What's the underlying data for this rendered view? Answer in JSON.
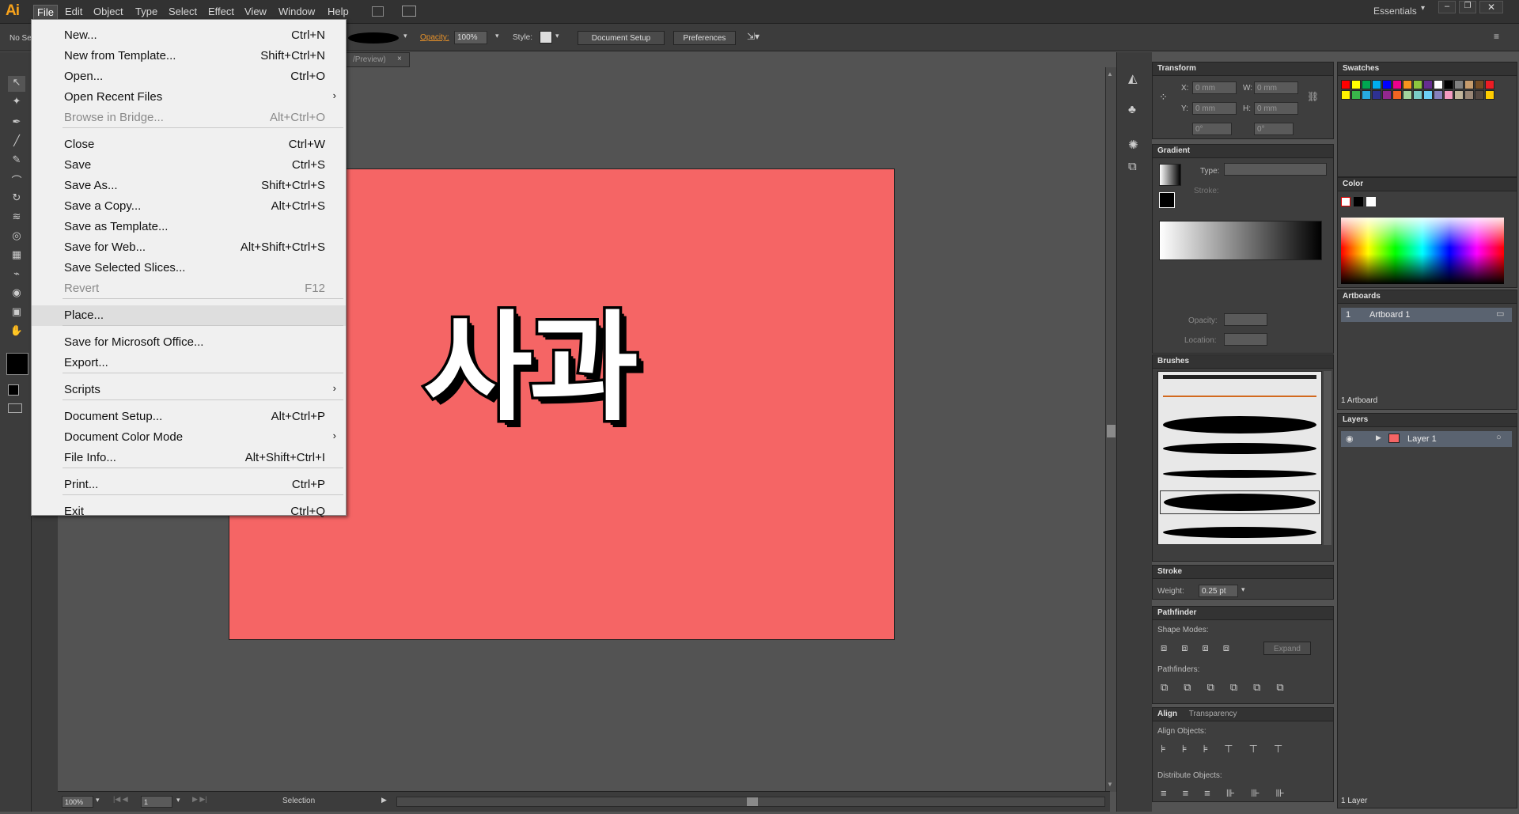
{
  "app": {
    "logo": "Ai",
    "workspace": "Essentials"
  },
  "menubar": [
    "File",
    "Edit",
    "Object",
    "Type",
    "Select",
    "Effect",
    "View",
    "Window",
    "Help"
  ],
  "control_bar": {
    "selection_label": "No Se",
    "opacity_label": "Opacity:",
    "opacity_value": "100%",
    "style_label": "Style:",
    "document_setup": "Document Setup",
    "preferences": "Preferences"
  },
  "document_tab": {
    "title": "/Preview)",
    "close": "×"
  },
  "artwork_text": "사과",
  "file_menu": [
    {
      "label": "New...",
      "shortcut": "Ctrl+N"
    },
    {
      "label": "New from Template...",
      "shortcut": "Shift+Ctrl+N"
    },
    {
      "label": "Open...",
      "shortcut": "Ctrl+O"
    },
    {
      "label": "Open Recent Files",
      "shortcut": "",
      "submenu": true
    },
    {
      "label": "Browse in Bridge...",
      "shortcut": "Alt+Ctrl+O",
      "disabled": true
    },
    {
      "label": "Close",
      "shortcut": "Ctrl+W"
    },
    {
      "label": "Save",
      "shortcut": "Ctrl+S"
    },
    {
      "label": "Save As...",
      "shortcut": "Shift+Ctrl+S"
    },
    {
      "label": "Save a Copy...",
      "shortcut": "Alt+Ctrl+S"
    },
    {
      "label": "Save as Template...",
      "shortcut": ""
    },
    {
      "label": "Save for Web...",
      "shortcut": "Alt+Shift+Ctrl+S"
    },
    {
      "label": "Save Selected Slices...",
      "shortcut": ""
    },
    {
      "label": "Revert",
      "shortcut": "F12",
      "disabled": true
    },
    {
      "label": "Place...",
      "shortcut": "",
      "hover": true
    },
    {
      "label": "Save for Microsoft Office...",
      "shortcut": ""
    },
    {
      "label": "Export...",
      "shortcut": ""
    },
    {
      "label": "Scripts",
      "shortcut": "",
      "submenu": true
    },
    {
      "label": "Document Setup...",
      "shortcut": "Alt+Ctrl+P"
    },
    {
      "label": "Document Color Mode",
      "shortcut": "",
      "submenu": true
    },
    {
      "label": "File Info...",
      "shortcut": "Alt+Shift+Ctrl+I"
    },
    {
      "label": "Print...",
      "shortcut": "Ctrl+P"
    },
    {
      "label": "Exit",
      "shortcut": "Ctrl+Q"
    }
  ],
  "status_bar": {
    "zoom": "100%",
    "page": "1",
    "mode": "Selection"
  },
  "panels": {
    "transform": {
      "title": "Transform",
      "x_label": "X:",
      "x": "0 mm",
      "y_label": "Y:",
      "y": "0 mm",
      "w_label": "W:",
      "w": "0 mm",
      "h_label": "H:",
      "h": "0 mm",
      "angle": "0°",
      "shear": "0°"
    },
    "gradient": {
      "title": "Gradient",
      "type_label": "Type:",
      "stroke_label": "Stroke:",
      "opacity_label": "Opacity:",
      "location_label": "Location:"
    },
    "brushes": {
      "title": "Brushes"
    },
    "stroke": {
      "title": "Stroke",
      "weight_label": "Weight:",
      "weight": "0.25 pt"
    },
    "pathfinder": {
      "title": "Pathfinder",
      "shape_modes": "Shape Modes:",
      "expand": "Expand",
      "pathfinders": "Pathfinders:"
    },
    "align": {
      "title": "Align",
      "tab2": "Transparency",
      "align_objects": "Align Objects:",
      "distribute_objects": "Distribute Objects:"
    },
    "swatches": {
      "title": "Swatches"
    },
    "color": {
      "title": "Color"
    },
    "artboards": {
      "title": "Artboards",
      "row_index": "1",
      "row_name": "Artboard 1",
      "footer": "1 Artboard"
    },
    "layers": {
      "title": "Layers",
      "layer_name": "Layer 1",
      "footer": "1 Layer"
    }
  },
  "swatch_colors": [
    "#ff0000",
    "#ffff00",
    "#00a651",
    "#00aeef",
    "#0000ff",
    "#ec008c",
    "#f7941d",
    "#8dc63f",
    "#662d91",
    "#ffffff",
    "#000000",
    "#808080",
    "#c69c6d",
    "#754c24",
    "#ed1c24",
    "#fff200",
    "#39b54a",
    "#27aae1",
    "#2e3192",
    "#92278f",
    "#f26522",
    "#a3d39c",
    "#7accc8",
    "#6dcff6",
    "#8781bd",
    "#f49ac1",
    "#c2b59b",
    "#998675",
    "#534741",
    "#ffcc00"
  ]
}
